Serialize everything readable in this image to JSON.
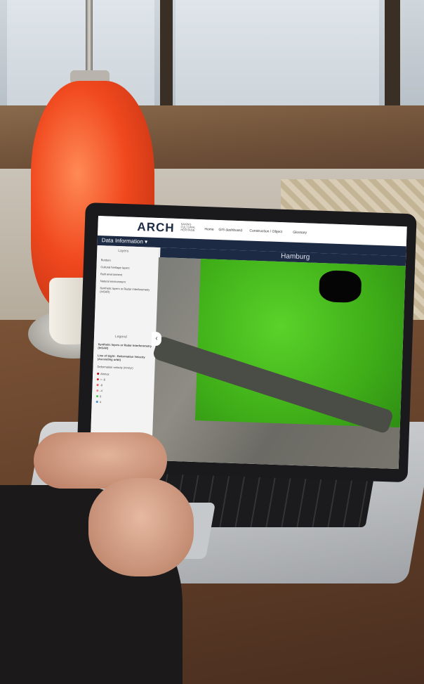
{
  "app": {
    "logo": "ARCH",
    "logo_sub": "SAVING CULTURAL HERITAGE"
  },
  "nav": {
    "home": "Home",
    "dashboard": "GIS dashboard",
    "construction": "Construction / Object",
    "glossary": "Glossary"
  },
  "sidebar": {
    "menu_label": "Data Information ▾",
    "layers_title": "Layers",
    "layers": [
      "Borders",
      "Cultural heritage layers",
      "Built environment",
      "Natural environment",
      "Synthetic layers or Radar Interferometry (InSAR)"
    ],
    "legend_title": "Legend",
    "legend_heading": "Synthetic layers or Radar Interferometry (InSAR)",
    "legend_subheading": "Line of Sight - Deformation Velocity (Ascending orbit)",
    "legend_caption": "Deformation velocity (mm/yr)",
    "legend_items": [
      "Ahmoz",
      "< -8",
      "-8",
      "-4",
      "0",
      "4"
    ]
  },
  "map": {
    "title": "Hamburg"
  },
  "colors": {
    "navy": "#1c2a44",
    "green": "#4cc41f",
    "lamp": "#f0481e"
  }
}
